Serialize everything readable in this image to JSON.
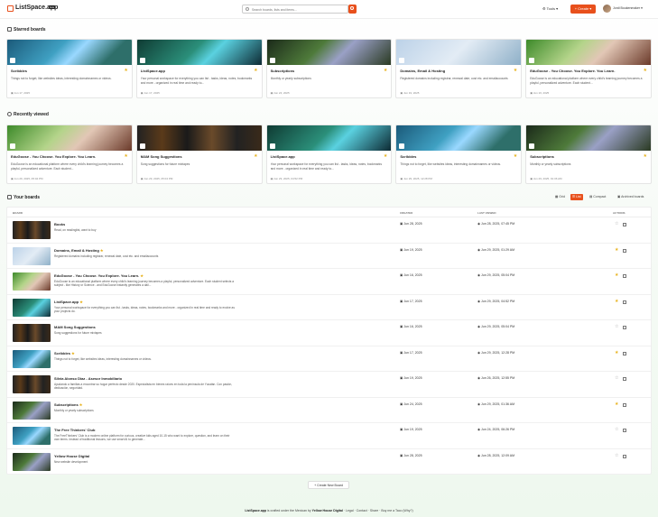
{
  "header": {
    "brand": "ListSpace.app",
    "badge": "beta",
    "search_placeholder": "Search boards, lists and items...",
    "tools": "Tools",
    "create": "Create",
    "user": "Jordi Boukenmaker"
  },
  "sections": {
    "starred": "Starred boards",
    "recent": "Recently viewed",
    "yours": "Your boards"
  },
  "starred": [
    {
      "title": "Scribbles",
      "desc": "Things not to forget, like websites ideas, interesting domainnames or videos.",
      "date": "Jun 17, 2025",
      "img": "g1"
    },
    {
      "title": "ListSpace.app",
      "desc": "Your personal workspace for everything you can list - tasks, ideas, notes, bookmarks and more - organized in real time and ready to...",
      "date": "Jun 17, 2025",
      "img": "g2"
    },
    {
      "title": "Subscriptions",
      "desc": "Monthly or yearly subscriptions",
      "date": "Jun 24, 2025",
      "img": "g3"
    },
    {
      "title": "Domains, Email & Hosting",
      "desc": "Registered domains including registrar, renewal date, cost etc. and emailaccounts",
      "date": "Jun 19, 2025",
      "img": "g4"
    },
    {
      "title": "EduGoose - You Choose. You Explore. You Learn.",
      "desc": "EduGoose is an educational platform where every child's learning journey becomes a playful, personalized adventure. Each student...",
      "date": "Jun 16, 2025",
      "img": "g5"
    }
  ],
  "recent": [
    {
      "title": "EduGoose - You Choose. You Explore. You Learn.",
      "desc": "EduGoose is an educational platform where every child's learning journey becomes a playful, personalized adventure. Each student...",
      "date": "Jun 29, 2025, 05:04 PM",
      "img": "g5"
    },
    {
      "title": "MAM Song Suggestions",
      "desc": "Song suggestions for future mixtapes",
      "date": "Jun 29, 2025, 05:04 PM",
      "img": "g6"
    },
    {
      "title": "ListSpace.app",
      "desc": "Your personal workspace for everything you can list - tasks, ideas, notes, bookmarks and more - organized in real time and ready to...",
      "date": "Jun 29, 2025, 04:52 PM",
      "img": "g2"
    },
    {
      "title": "Scribbles",
      "desc": "Things not to forget, like websites ideas, interesting domainnames or videos.",
      "date": "Jun 29, 2025, 12:28 PM",
      "img": "g1"
    },
    {
      "title": "Subscriptions",
      "desc": "Monthly or yearly subscriptions",
      "date": "Jun 29, 2025, 01:36 AM",
      "img": "g3"
    }
  ],
  "views": {
    "grid": "Grid",
    "list": "List",
    "compact": "Compact",
    "archived": "Archived boards"
  },
  "columns": {
    "board": "BOARD",
    "created": "CREATED",
    "viewed": "LAST VIEWED",
    "actions": "ACTIONS"
  },
  "boards": [
    {
      "title": "Books",
      "desc": "Read, on readinglist, want to buy",
      "created": "Jun 28, 2025",
      "viewed": "Jun 28, 2025, 07:45 PM",
      "starred": false,
      "img": "g6"
    },
    {
      "title": "Domains, Email & Hosting",
      "desc": "Registered domains including registrar, renewal date, cost etc. and emailaccounts",
      "created": "Jun 19, 2025",
      "viewed": "Jun 29, 2025, 01:29 AM",
      "starred": true,
      "img": "g4"
    },
    {
      "title": "EduGoose - You Choose. You Explore. You Learn.",
      "desc": "EduGoose is an educational platform where every child's learning journey becomes a playful, personalized adventure. Each student selects a subject - like History or Science - and EduGoose instantly generates a dail...",
      "created": "Jun 16, 2025",
      "viewed": "Jun 29, 2025, 05:04 PM",
      "starred": true,
      "img": "g5"
    },
    {
      "title": "ListSpace.app",
      "desc": "Your personal workspace for everything you can list - tasks, ideas, notes, bookmarks and more - organized in real time and ready to evolve as your projects do.",
      "created": "Jun 17, 2025",
      "viewed": "Jun 29, 2025, 04:52 PM",
      "starred": true,
      "img": "g2"
    },
    {
      "title": "MAM Song Suggestions",
      "desc": "Song suggestions for future mixtapes",
      "created": "Jun 16, 2025",
      "viewed": "Jun 29, 2025, 05:04 PM",
      "starred": false,
      "img": "g6"
    },
    {
      "title": "Scribbles",
      "desc": "Things not to forget, like websites ideas, interesting domainnames or videos.",
      "created": "Jun 17, 2025",
      "viewed": "Jun 29, 2025, 12:28 PM",
      "starred": true,
      "img": "g1"
    },
    {
      "title": "Silvia Alonso Diaz - Asesor Inmobiliario",
      "desc": "Ayudando a familias a encontrar su hogar perfecto desde 2020. Especialista en bienes raíces en toda la península de Yucatán. Con pasión, dedicación, seguridad.",
      "created": "Jun 19, 2025",
      "viewed": "Jun 26, 2025, 12:55 PM",
      "starred": false,
      "img": "g6"
    },
    {
      "title": "Subscriptions",
      "desc": "Monthly or yearly subscriptions",
      "created": "Jun 24, 2025",
      "viewed": "Jun 29, 2025, 01:36 AM",
      "starred": true,
      "img": "g3"
    },
    {
      "title": "The Free Thinkers' Club",
      "desc": "The FreeThinkers' Club is a modern online platform for curious, creative kids aged 10-15 who want to explore, question, and learn on their own terms. Instead of traditional lessons, we use smart AI to generate...",
      "created": "Jun 19, 2025",
      "viewed": "Jun 24, 2025, 06:26 PM",
      "starred": false,
      "img": "g1"
    },
    {
      "title": "Yellow House Digital",
      "desc": "New website development",
      "created": "Jun 28, 2025",
      "viewed": "Jun 28, 2025, 12:09 AM",
      "starred": false,
      "img": "g3"
    }
  ],
  "create_board": "Create New Board",
  "footer": {
    "brand": "ListSpace.app",
    "mid": "is crafted under the Mexican",
    "by": "by",
    "company": "Yellow House Digital",
    "links": "Legal · Contact · Share · Buy me a Taco (Why?)"
  }
}
